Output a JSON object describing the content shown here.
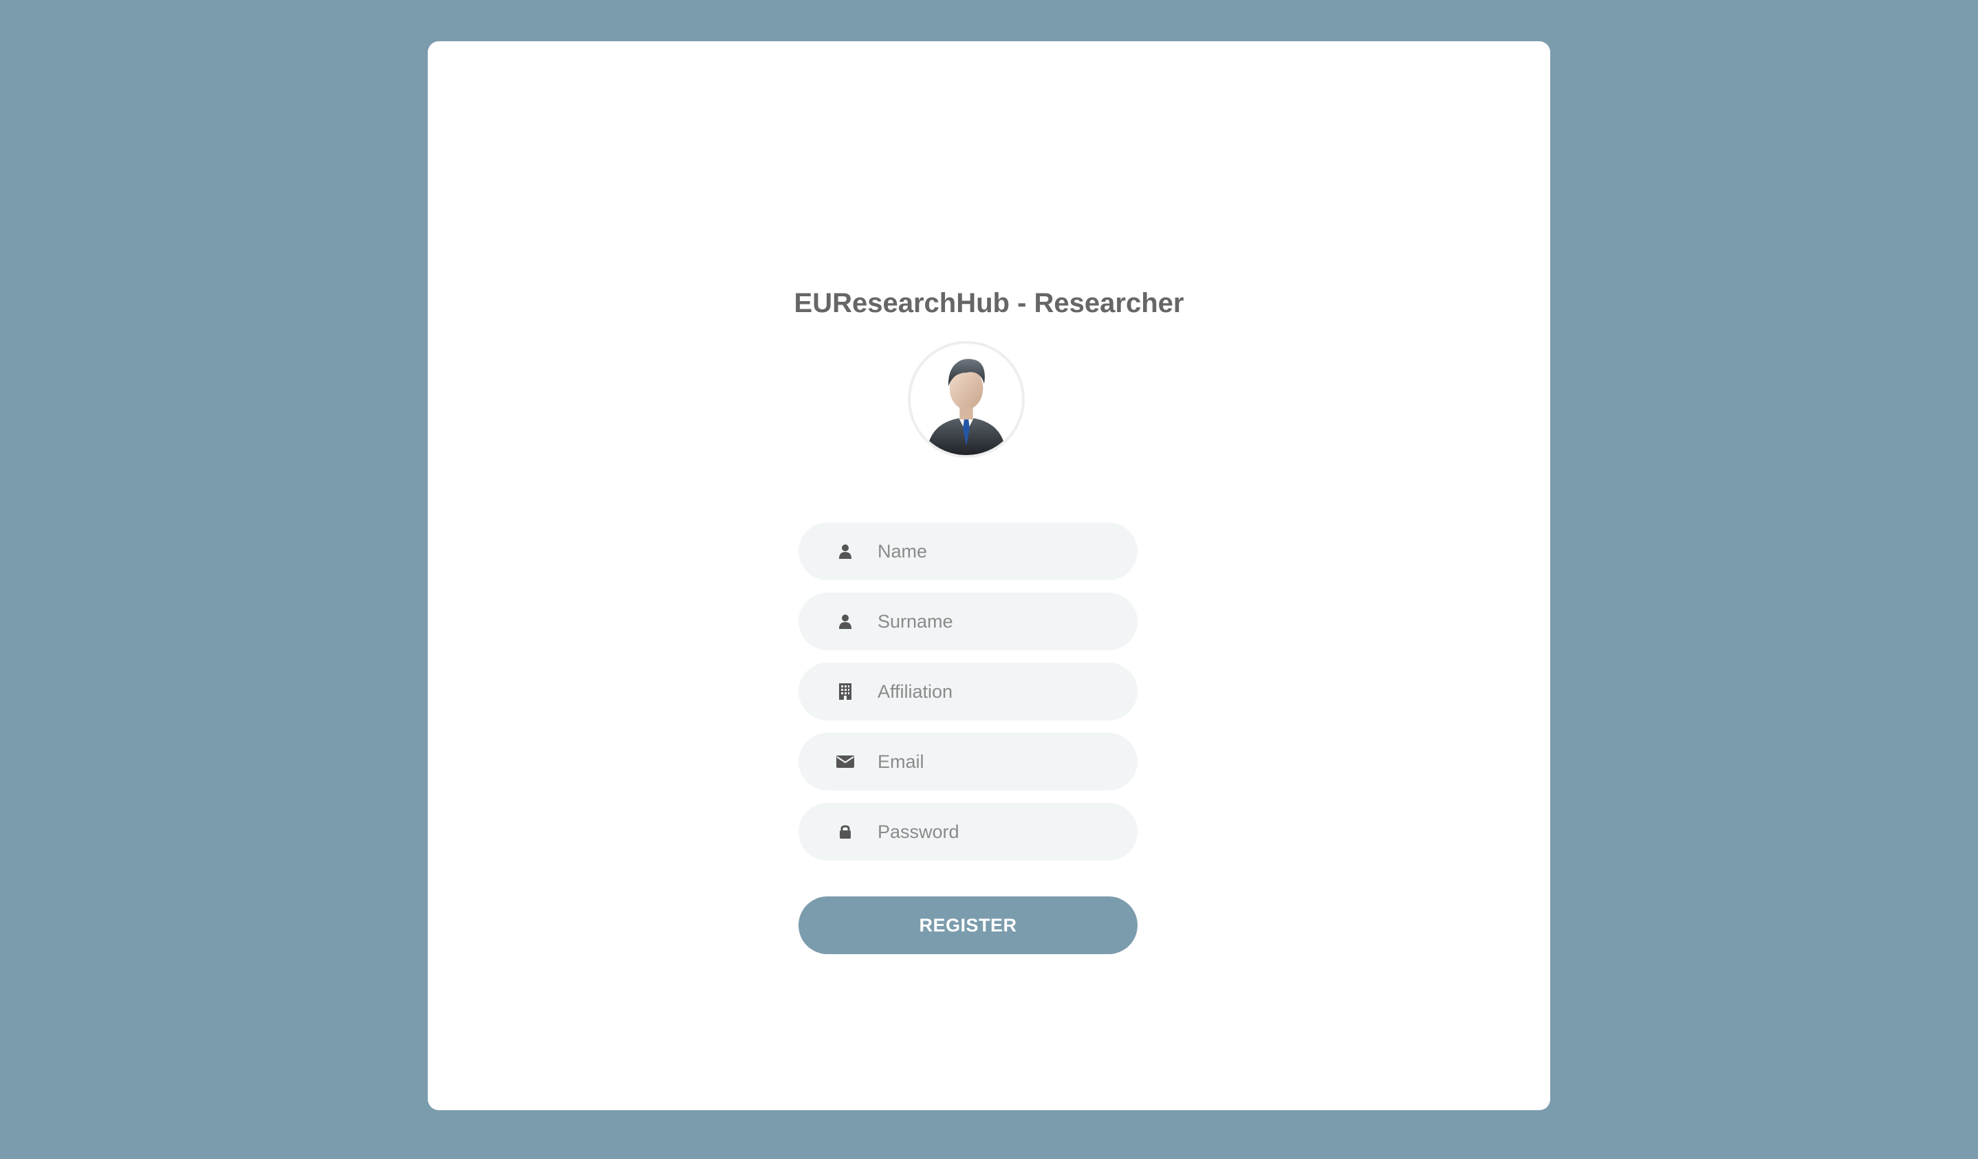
{
  "page": {
    "title": "EUResearchHub - Researcher",
    "background_color": "#7b9cad"
  },
  "avatar": {
    "icon": "businessman-avatar"
  },
  "form": {
    "fields": [
      {
        "placeholder": "Name",
        "value": "",
        "icon": "user-icon",
        "type": "text"
      },
      {
        "placeholder": "Surname",
        "value": "",
        "icon": "user-icon",
        "type": "text"
      },
      {
        "placeholder": "Affiliation",
        "value": "",
        "icon": "building-icon",
        "type": "text"
      },
      {
        "placeholder": "Email",
        "value": "",
        "icon": "envelope-icon",
        "type": "email"
      },
      {
        "placeholder": "Password",
        "value": "",
        "icon": "lock-icon",
        "type": "password"
      }
    ],
    "submit_label": "REGISTER",
    "accent_color": "#7b9cad"
  }
}
